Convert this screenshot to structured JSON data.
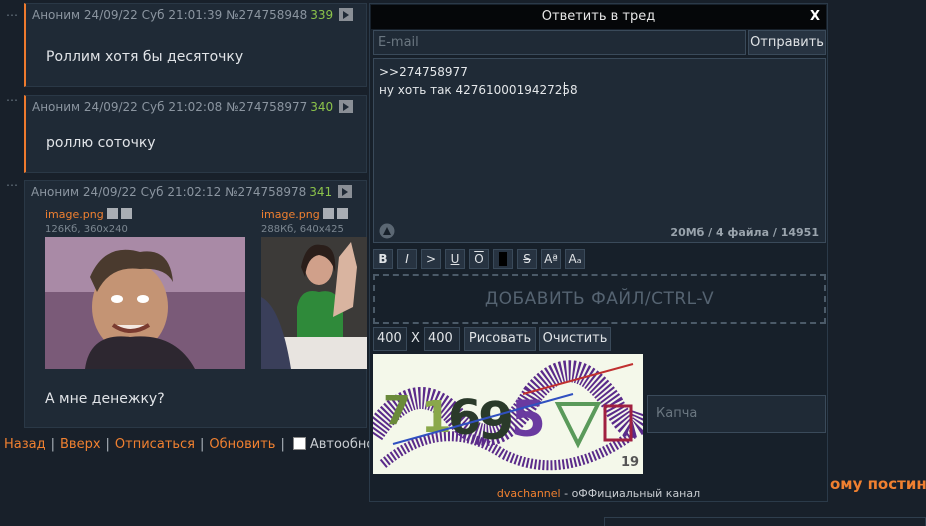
{
  "posts": [
    {
      "name": "Аноним",
      "date": "24/09/22 Суб 21:01:39",
      "num": "№274758948",
      "replies": "339",
      "text": "Роллим хотя бы десяточку"
    },
    {
      "name": "Аноним",
      "date": "24/09/22 Суб 21:02:08",
      "num": "№274758977",
      "replies": "340",
      "text": "роллю соточку"
    },
    {
      "name": "Аноним",
      "date": "24/09/22 Суб 21:02:12",
      "num": "№274758978",
      "replies": "341",
      "text": "А мне денежку?",
      "files": [
        {
          "name": "image.png",
          "meta": "126Кб, 360x240"
        },
        {
          "name": "image.png",
          "meta": "288Кб, 640x425"
        }
      ]
    }
  ],
  "nav": {
    "back": "Назад",
    "top": "Вверх",
    "unsub": "Отписаться",
    "refresh": "Обновить",
    "auto": "Автообновлен"
  },
  "reply": {
    "title": "Ответить в тред",
    "close": "X",
    "email_placeholder": "E-mail",
    "submit": "Отправить",
    "lines": [
      ">>274758977",
      "ну хоть так 4276100019427258"
    ],
    "counter": "20Мб / 4 файла / 14951",
    "toolbar": [
      "B",
      "I",
      ">",
      "U",
      "O",
      "",
      "S",
      "Aª",
      "Aₐ"
    ],
    "dropzone": "ДОБАВИТЬ ФАЙЛ/CTRL-V",
    "width": "400",
    "x": "X",
    "height": "400",
    "draw": "Рисовать",
    "clear": "Очистить",
    "captcha_placeholder": "Капча",
    "captcha_num": "19",
    "footer_link": "dvachannel",
    "footer_text": " - оФФициальный канал"
  },
  "right_text": "ому постинга",
  "colors": {
    "accent": "#f08030",
    "replies": "#8bc34a",
    "bg": "#18202a",
    "post_bg": "#1f2a36"
  }
}
